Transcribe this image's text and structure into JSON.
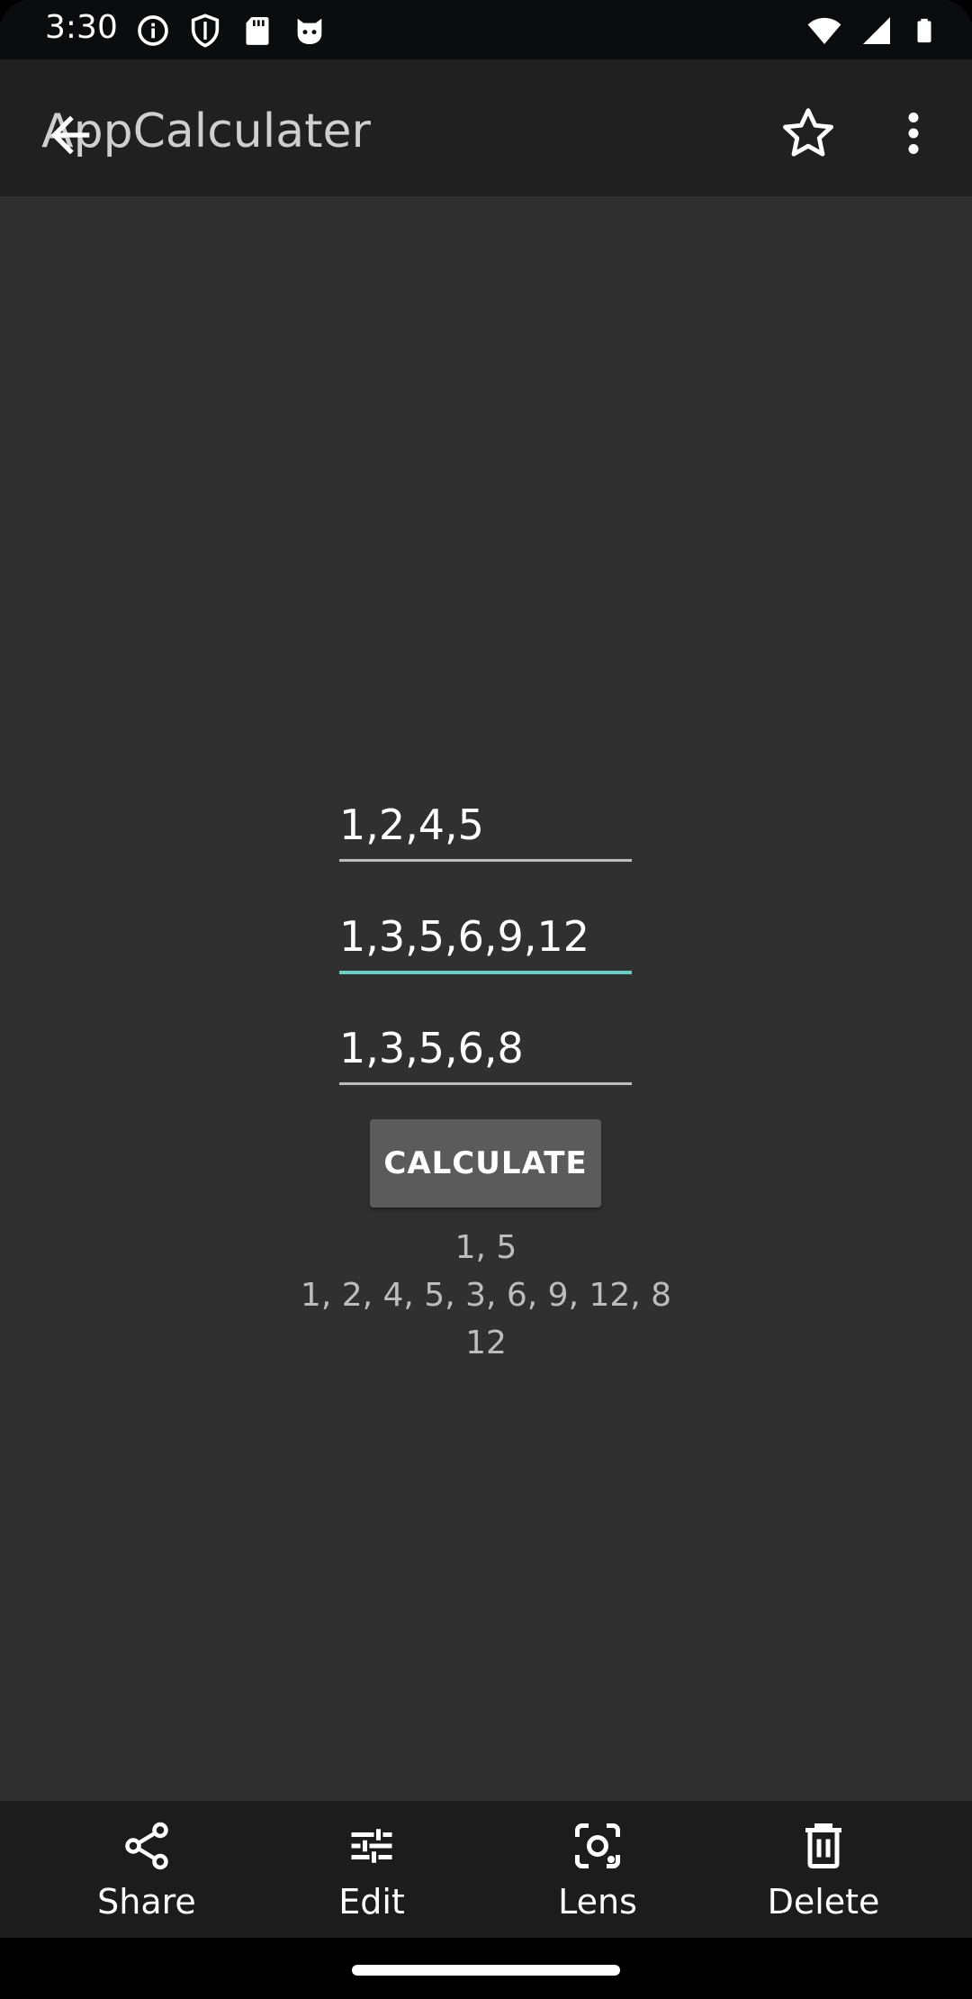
{
  "status_bar": {
    "time": "3:30",
    "icons_left": [
      "info-icon",
      "shield-icon",
      "sd-card-icon",
      "cat-icon"
    ],
    "icons_right": [
      "wifi-icon",
      "signal-icon",
      "battery-icon"
    ]
  },
  "app_bar": {
    "title": "AppCalculater",
    "back_icon": "arrow-back-icon",
    "star_icon": "star-outline-icon",
    "more_icon": "more-vert-icon"
  },
  "form": {
    "fields": [
      {
        "value": "1,2,4,5",
        "focused": false
      },
      {
        "value": "1,3,5,6,9,12",
        "focused": true
      },
      {
        "value": "1,3,5,6,8",
        "focused": false
      }
    ],
    "button_label": "CALCULATE",
    "results": [
      "1, 5",
      "1, 2, 4, 5, 3, 6, 9, 12, 8",
      "12"
    ]
  },
  "bottom_actions": [
    {
      "label": "Share",
      "icon": "share-icon"
    },
    {
      "label": "Edit",
      "icon": "tune-icon"
    },
    {
      "label": "Lens",
      "icon": "lens-icon"
    },
    {
      "label": "Delete",
      "icon": "trash-icon"
    }
  ],
  "colors": {
    "background": "#303030",
    "app_bar": "#202020",
    "focus_underline": "#6ecbc6",
    "button": "#5b5b5b"
  }
}
